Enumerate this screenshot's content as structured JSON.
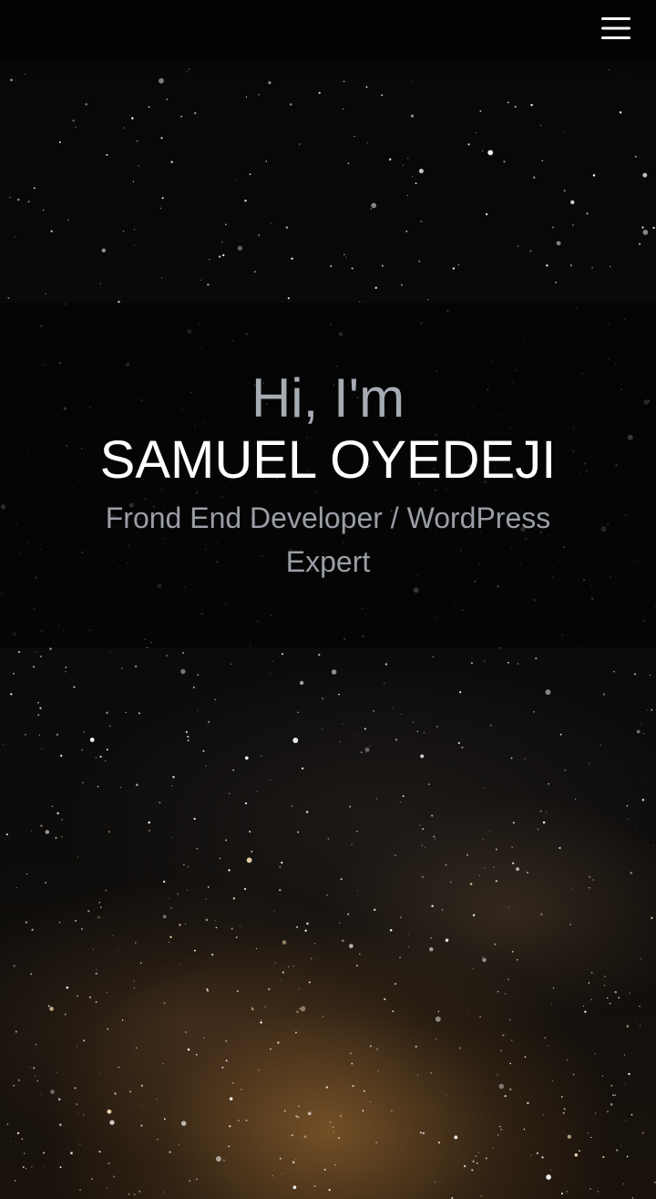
{
  "header": {
    "menu_icon": "hamburger-menu-icon"
  },
  "hero": {
    "greeting": "Hi, I'm",
    "name": "SAMUEL OYEDEJI",
    "role": "Frond End Developer / WordPress Expert",
    "background": "starry night sky with milky way"
  },
  "colors": {
    "topbar": "#030303",
    "greeting": "#a7acb3",
    "name": "#ffffff",
    "role": "#9a9ea5"
  }
}
